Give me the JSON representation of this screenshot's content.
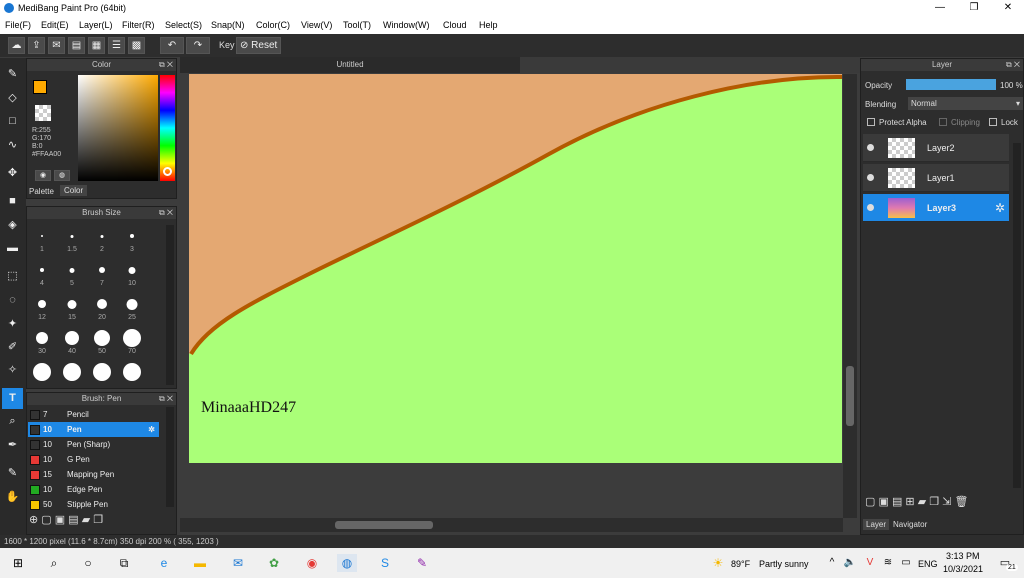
{
  "window": {
    "title": "MediBang Paint Pro (64bit)",
    "min": "—",
    "max": "❐",
    "close": "✕"
  },
  "menu": [
    "File(F)",
    "Edit(E)",
    "Layer(L)",
    "Filter(R)",
    "Select(S)",
    "Snap(N)",
    "Color(C)",
    "View(V)",
    "Tool(T)",
    "Window(W)",
    "Cloud",
    "Help"
  ],
  "toolbar": {
    "key_label": "Key",
    "reset_label": "Reset"
  },
  "color_panel": {
    "title": "Color",
    "r": "R:255",
    "g": "G:170",
    "b": "B:0",
    "hex": "#FFAA00",
    "tab_palette": "Palette",
    "tab_color": "Color",
    "fg": "#ffaa00"
  },
  "brush_size_panel": {
    "title": "Brush Size",
    "sizes": [
      "1",
      "1.5",
      "2",
      "3",
      "4",
      "5",
      "7",
      "10",
      "12",
      "15",
      "20",
      "25",
      "30",
      "40",
      "50",
      "70",
      "",
      "",
      "",
      ""
    ]
  },
  "brush_panel": {
    "title": "Brush: Pen",
    "items": [
      {
        "size": "7",
        "name": "Pencil",
        "color": "#333333"
      },
      {
        "size": "10",
        "name": "Pen",
        "color": "#333333",
        "selected": true
      },
      {
        "size": "10",
        "name": "Pen (Sharp)",
        "color": "#333333"
      },
      {
        "size": "10",
        "name": "G Pen",
        "color": "#e53935"
      },
      {
        "size": "15",
        "name": "Mapping Pen",
        "color": "#e53935"
      },
      {
        "size": "10",
        "name": "Edge Pen",
        "color": "#22aa22"
      },
      {
        "size": "50",
        "name": "Stipple Pen",
        "color": "#f5c400"
      }
    ]
  },
  "document": {
    "tab_title": "Untitled",
    "canvas_text": "MinaaaHD247",
    "bg_color": "#aaff78",
    "sky_color": "#e4a872",
    "line_color": "#b35a00"
  },
  "layer_panel": {
    "title": "Layer",
    "opacity_label": "Opacity",
    "opacity_value": "100 %",
    "opacity_fraction": 1.0,
    "blending_label": "Blending",
    "blending_value": "Normal",
    "protect_alpha": "Protect Alpha",
    "clipping": "Clipping",
    "lock": "Lock",
    "layers": [
      {
        "name": "Layer2",
        "selected": false
      },
      {
        "name": "Layer1",
        "selected": false
      },
      {
        "name": "Layer3",
        "selected": true
      }
    ],
    "tab_layer": "Layer",
    "tab_navigator": "Navigator"
  },
  "status": {
    "text": "1600 * 1200 pixel   (11.6 * 8.7cm)   350 dpi   200 %   ( 355, 1203 )"
  },
  "taskbar": {
    "weather_temp": "89°F",
    "weather_text": "Partly sunny",
    "lang": "ENG",
    "time": "3:13 PM",
    "date": "10/3/2021",
    "notif_count": "21"
  }
}
